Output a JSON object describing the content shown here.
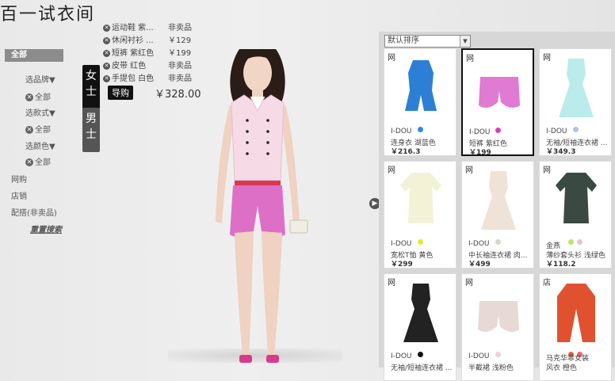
{
  "app": {
    "title": "百一试衣间"
  },
  "filters": {
    "all_label": "全部",
    "brand_label": "选品牌▼",
    "brand_value": "全部",
    "style_label": "选款式▼",
    "style_value": "全部",
    "color_label": "选颜色▼",
    "color_value": "全部",
    "link_online": "网购",
    "link_store": "店销",
    "link_match": "配搭(非卖品)",
    "reset": "重置搜索",
    "chip_glyph": "✕"
  },
  "gender": {
    "female": "女士",
    "male": "男士"
  },
  "outfit": {
    "items": [
      {
        "name": "运动鞋 紫...",
        "price": "非卖品"
      },
      {
        "name": "休闲衬衫 ...",
        "price": "￥129"
      },
      {
        "name": "短裤 紫红色",
        "price": "￥199"
      },
      {
        "name": "皮带 红色",
        "price": "非卖品"
      },
      {
        "name": "手提包 白色",
        "price": "非卖品"
      }
    ],
    "remove_glyph": "✕",
    "buy_label": "导购",
    "total": "￥328.00"
  },
  "sort": {
    "value": "默认排序",
    "caret": "▼"
  },
  "nav": {
    "arrow": "▶"
  },
  "products": [
    {
      "tag": "网",
      "brand": "I-DOU",
      "name": "连身衣 湖蓝色",
      "price": "￥216.3",
      "colors": [
        "#2f8be0"
      ],
      "garment": "#2d7fd6",
      "kind": "romper",
      "selected": false
    },
    {
      "tag": "网",
      "brand": "I-DOU",
      "name": "短裤 紫红色",
      "price": "￥199",
      "colors": [
        "#d63fbf"
      ],
      "garment": "#e07ad2",
      "kind": "shorts",
      "selected": true
    },
    {
      "tag": "网",
      "brand": "I-DOU",
      "name": "无袖/短袖连衣裙 ...",
      "price": "￥349.3",
      "colors": [
        "#aec4e8"
      ],
      "garment": "#b9ecea",
      "kind": "dress",
      "selected": false
    },
    {
      "tag": "网",
      "brand": "I-DOU",
      "name": "宽松T恤 黄色",
      "price": "￥299",
      "colors": [
        "#e8e830"
      ],
      "garment": "#f3f2d6",
      "kind": "top",
      "selected": false
    },
    {
      "tag": "网",
      "brand": "I-DOU",
      "name": "中长袖连衣裙 肉...",
      "price": "￥499",
      "colors": [
        "#d9d4cc"
      ],
      "garment": "#eee3d6",
      "kind": "dress",
      "selected": false
    },
    {
      "tag": "网",
      "brand": "金燕",
      "name": "薄纱套头衫 浅绿色",
      "price": "￥118.2",
      "colors": [
        "#b5e86f",
        "#e2c6cf"
      ],
      "garment": "#3a4a42",
      "kind": "top",
      "selected": false
    },
    {
      "tag": "网",
      "brand": "I-DOU",
      "name": "无袖/短袖连衣裙 ...",
      "price": "",
      "colors": [
        "#111111"
      ],
      "garment": "#222222",
      "kind": "dress",
      "selected": false
    },
    {
      "tag": "网",
      "brand": "I-DOU",
      "name": "半截裙 浅粉色",
      "price": "",
      "colors": [
        "#ecd2d7"
      ],
      "garment": "#e7d9d6",
      "kind": "shorts",
      "selected": false
    },
    {
      "tag": "店",
      "brand": "马克华菲女装",
      "name": "风衣 橙色",
      "price": "",
      "colors": [
        "#e8643e",
        "#e86a6a"
      ],
      "garment": "#e0522f",
      "kind": "coat",
      "selected": false
    }
  ]
}
